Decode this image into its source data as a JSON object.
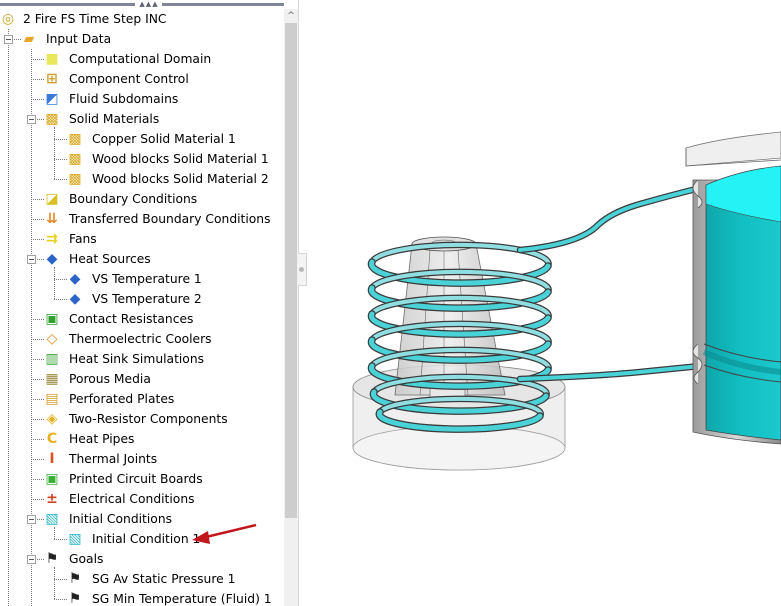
{
  "splitter": {
    "grip": "▲▲▲"
  },
  "tree": {
    "root": {
      "label": "2 Fire FS Time Step INC",
      "icon": "project-icon"
    },
    "items": [
      {
        "label": "Input Data",
        "level": 1,
        "icon": "folder-icon",
        "expanded": true
      },
      {
        "label": "Computational Domain",
        "level": 2,
        "icon": "computational-domain-icon"
      },
      {
        "label": "Component Control",
        "level": 2,
        "icon": "component-control-icon"
      },
      {
        "label": "Fluid Subdomains",
        "level": 2,
        "icon": "fluid-subdomain-icon"
      },
      {
        "label": "Solid Materials",
        "level": 2,
        "icon": "solid-material-icon",
        "expanded": true
      },
      {
        "label": "Copper Solid Material 1",
        "level": 3,
        "icon": "solid-material-icon"
      },
      {
        "label": "Wood blocks Solid Material 1",
        "level": 3,
        "icon": "solid-material-icon"
      },
      {
        "label": "Wood blocks Solid Material 2",
        "level": 3,
        "icon": "solid-material-icon"
      },
      {
        "label": "Boundary Conditions",
        "level": 2,
        "icon": "boundary-condition-icon"
      },
      {
        "label": "Transferred Boundary Conditions",
        "level": 2,
        "icon": "transferred-boundary-icon"
      },
      {
        "label": "Fans",
        "level": 2,
        "icon": "fan-icon"
      },
      {
        "label": "Heat Sources",
        "level": 2,
        "icon": "heat-source-icon",
        "expanded": true
      },
      {
        "label": "VS Temperature 1",
        "level": 3,
        "icon": "heat-source-icon"
      },
      {
        "label": "VS Temperature 2",
        "level": 3,
        "icon": "heat-source-icon"
      },
      {
        "label": "Contact Resistances",
        "level": 2,
        "icon": "contact-resistance-icon"
      },
      {
        "label": "Thermoelectric Coolers",
        "level": 2,
        "icon": "thermoelectric-cooler-icon"
      },
      {
        "label": "Heat Sink Simulations",
        "level": 2,
        "icon": "heat-sink-icon"
      },
      {
        "label": "Porous Media",
        "level": 2,
        "icon": "porous-media-icon"
      },
      {
        "label": "Perforated Plates",
        "level": 2,
        "icon": "perforated-plate-icon"
      },
      {
        "label": "Two-Resistor Components",
        "level": 2,
        "icon": "two-resistor-icon"
      },
      {
        "label": "Heat Pipes",
        "level": 2,
        "icon": "heat-pipe-icon"
      },
      {
        "label": "Thermal Joints",
        "level": 2,
        "icon": "thermal-joint-icon"
      },
      {
        "label": "Printed Circuit Boards",
        "level": 2,
        "icon": "pcb-icon"
      },
      {
        "label": "Electrical Conditions",
        "level": 2,
        "icon": "electrical-condition-icon"
      },
      {
        "label": "Initial Conditions",
        "level": 2,
        "icon": "initial-condition-icon",
        "expanded": true
      },
      {
        "label": "Initial Condition 1",
        "level": 3,
        "icon": "initial-condition-icon",
        "annotated": true
      },
      {
        "label": "Goals",
        "level": 2,
        "icon": "goal-flag-icon",
        "expanded": true
      },
      {
        "label": "SG Av Static Pressure 1",
        "level": 3,
        "icon": "goal-flag-icon"
      },
      {
        "label": "SG Min Temperature (Fluid) 1",
        "level": 3,
        "icon": "goal-flag-icon"
      }
    ]
  },
  "scrollbar": {
    "up_glyph": "^"
  },
  "annotation": {
    "color": "#c0161c",
    "target": "Initial Condition 1"
  },
  "colors": {
    "coil": "#49d3d8",
    "water": "#17c0c4",
    "tree_line": "#7a7a7a",
    "scroll_thumb": "#cdcdcd"
  }
}
